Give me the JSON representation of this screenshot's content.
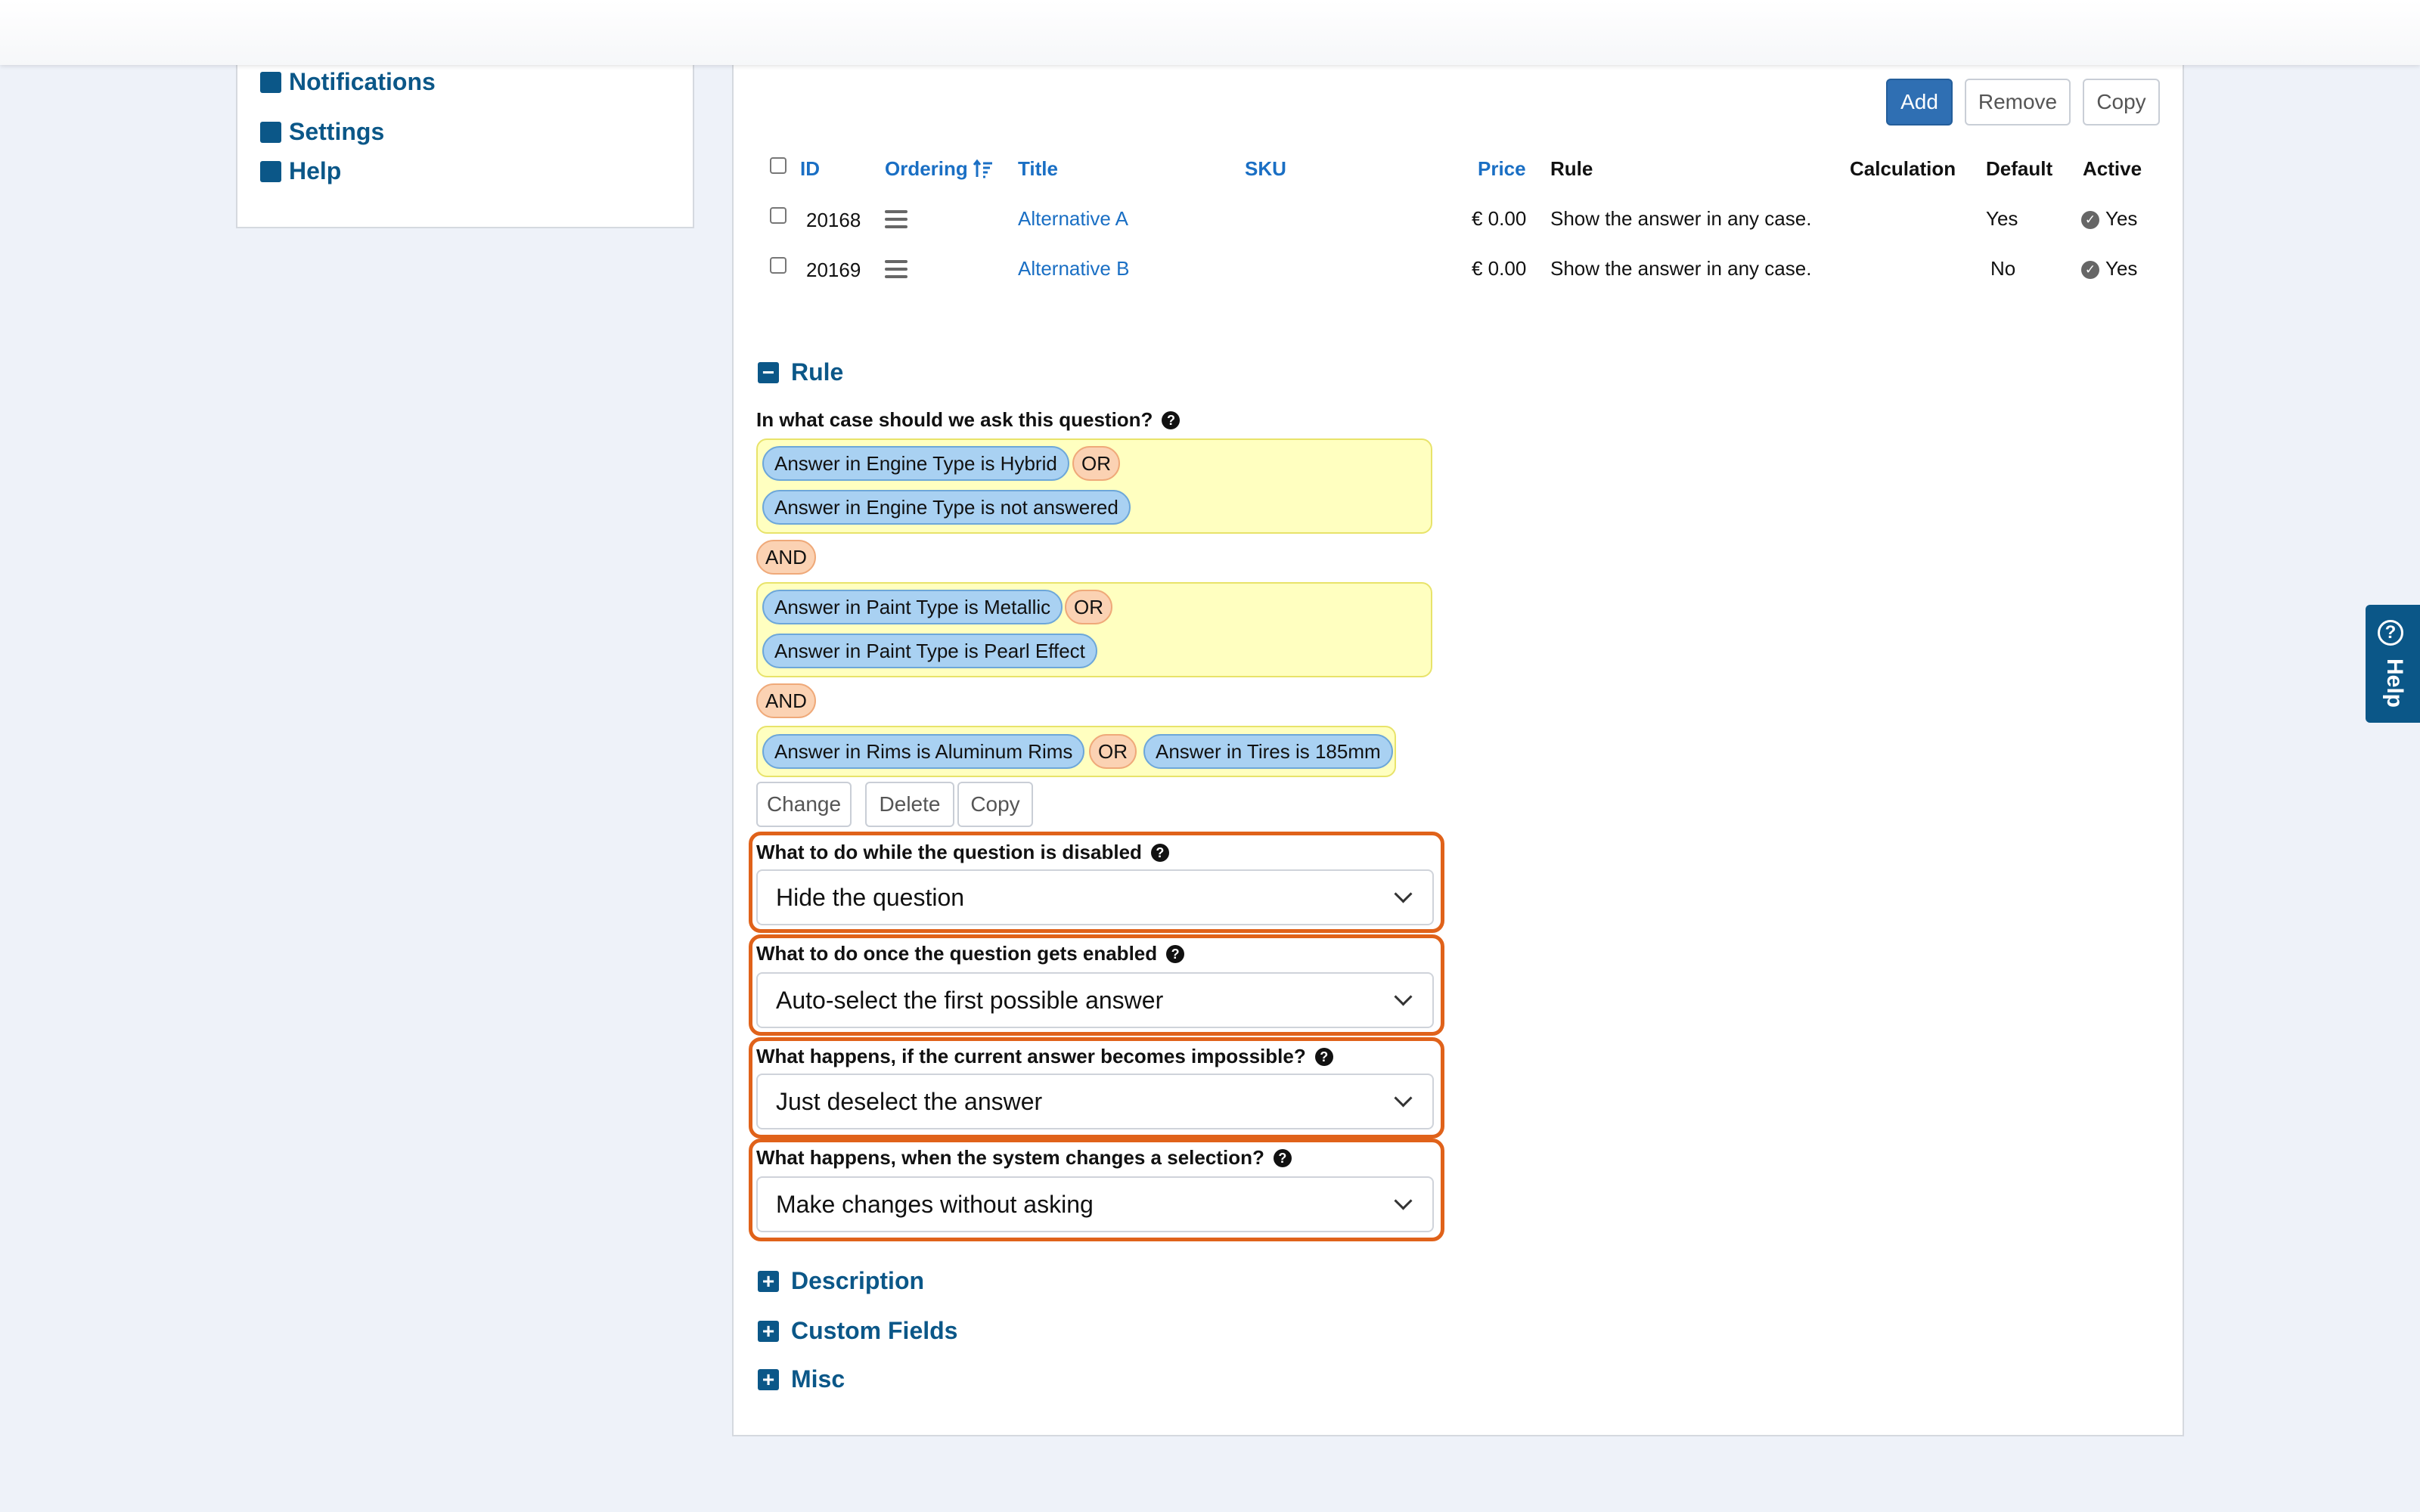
{
  "sidebar": {
    "items": [
      {
        "label": "Notifications"
      },
      {
        "label": "Settings"
      },
      {
        "label": "Help"
      }
    ]
  },
  "toolbar": {
    "add_label": "Add",
    "remove_label": "Remove",
    "copy_label": "Copy"
  },
  "table": {
    "columns": {
      "id": "ID",
      "ordering": "Ordering",
      "title": "Title",
      "sku": "SKU",
      "price": "Price",
      "rule": "Rule",
      "calculation": "Calculation",
      "default": "Default",
      "active": "Active"
    },
    "rows": [
      {
        "id": "20168",
        "title": "Alternative A",
        "sku": "",
        "price": "€ 0.00",
        "rule": "Show the answer in any case.",
        "calculation": "",
        "default": "Yes",
        "active": "Yes"
      },
      {
        "id": "20169",
        "title": "Alternative B",
        "sku": "",
        "price": "€ 0.00",
        "rule": "Show the answer in any case.",
        "calculation": "",
        "default": "No",
        "active": "Yes"
      }
    ]
  },
  "rule": {
    "title": "Rule",
    "question": "In what case should we ask this question?",
    "and_label": "AND",
    "or_label": "OR",
    "group1": [
      "Answer in Engine Type is Hybrid",
      "Answer in Engine Type is not answered"
    ],
    "group2": [
      "Answer in Paint Type is Metallic",
      "Answer in Paint Type is Pearl Effect"
    ],
    "group3": [
      "Answer in Rims is Aluminum Rims",
      "Answer in Tires is 185mm"
    ],
    "buttons": {
      "change": "Change",
      "delete": "Delete",
      "copy": "Copy"
    }
  },
  "settings": [
    {
      "label": "What to do while the question is disabled",
      "value": "Hide the question"
    },
    {
      "label": "What to do once the question gets enabled",
      "value": "Auto-select the first possible answer"
    },
    {
      "label": "What happens, if the current answer becomes impossible?",
      "value": "Just deselect the answer"
    },
    {
      "label": "What happens, when the system changes a selection?",
      "value": "Make changes without asking"
    }
  ],
  "sections": [
    {
      "label": "Description"
    },
    {
      "label": "Custom Fields"
    },
    {
      "label": "Misc"
    }
  ],
  "help_tab": {
    "label": "Help"
  },
  "icons": {
    "minus": "minus-square-icon",
    "plus": "plus-square-icon",
    "help": "question-circle-icon",
    "check": "check-circle-icon",
    "drag": "drag-handle-icon",
    "sort": "sort-icon",
    "chevron": "chevron-down-icon"
  },
  "colors": {
    "brand": "#0b5788",
    "link": "#1a6fc4",
    "primary_button": "#2f6fb3",
    "group_background": "#ffffc0",
    "condition_chip": "#a9d1f2",
    "operator_chip": "#fbd2b3",
    "highlight_border": "#e0621a"
  }
}
